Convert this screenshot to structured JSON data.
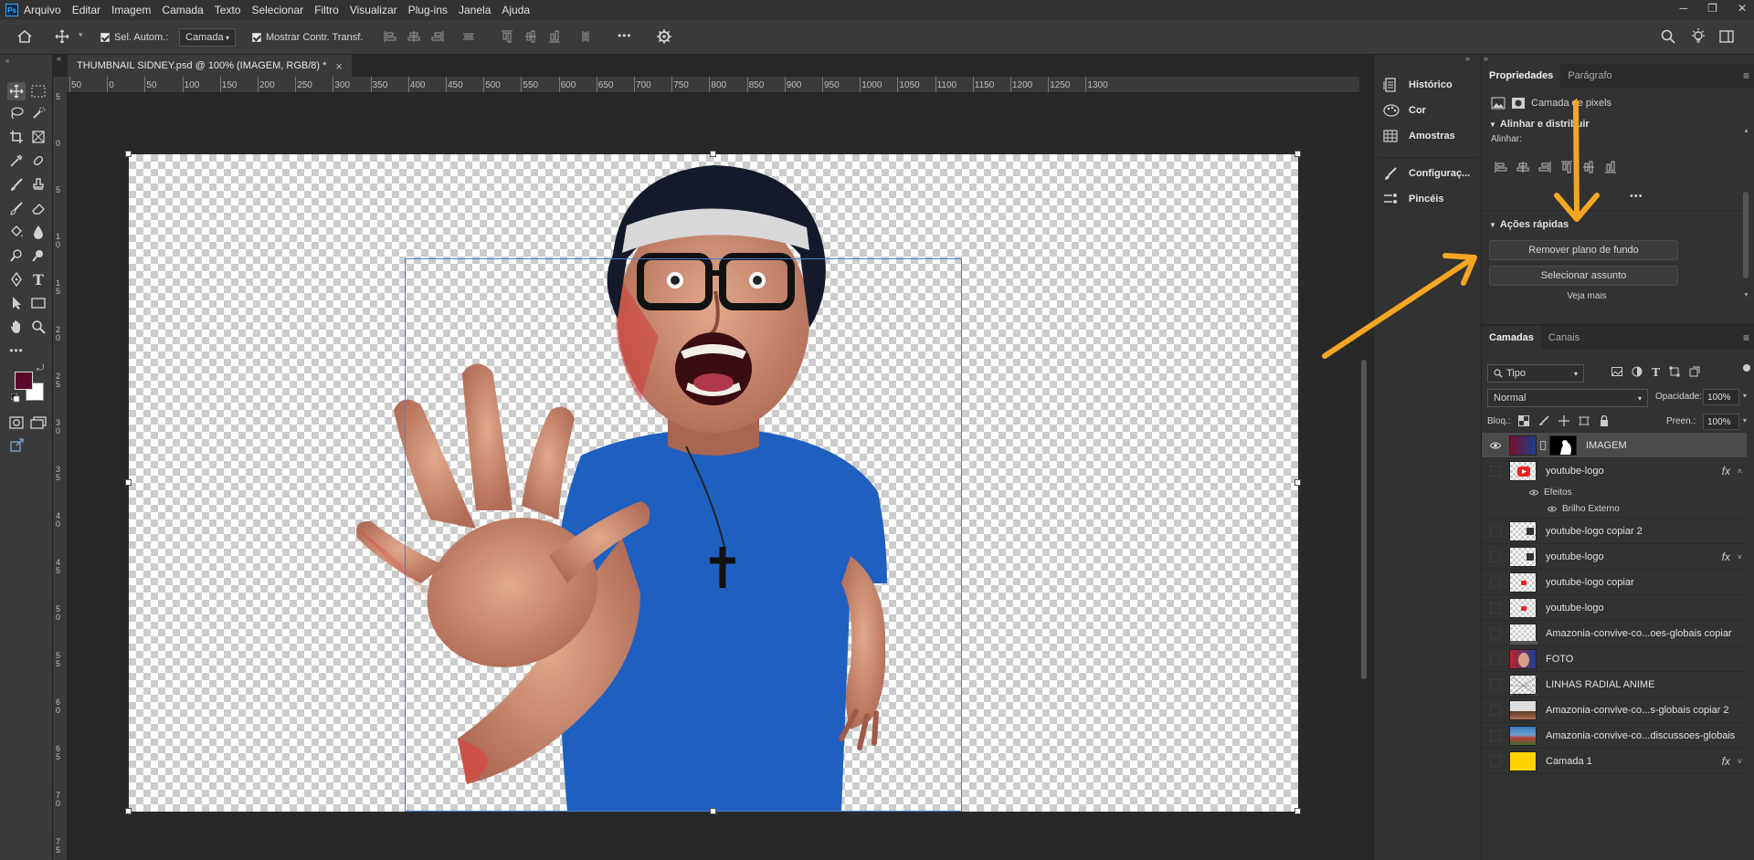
{
  "app": {
    "logo": "Ps"
  },
  "menu": [
    "Arquivo",
    "Editar",
    "Imagem",
    "Camada",
    "Texto",
    "Selecionar",
    "Filtro",
    "Visualizar",
    "Plug-ins",
    "Janela",
    "Ajuda"
  ],
  "options": {
    "auto_select_label": "Sel. Autom.:",
    "auto_select_value": "Camada",
    "show_transform_label": "Mostrar Contr. Transf.",
    "more": "•••"
  },
  "document": {
    "tab_title": "THUMBNAIL SIDNEY.psd @ 100% (IMAGEM, RGB/8) *",
    "close": "×"
  },
  "rulers": {
    "top": [
      "50",
      "0",
      "50",
      "100",
      "150",
      "200",
      "250",
      "300",
      "350",
      "400",
      "450",
      "500",
      "550",
      "600",
      "650",
      "700",
      "750",
      "800",
      "850",
      "900",
      "950",
      "1000",
      "1050",
      "1100",
      "1150",
      "1200",
      "1250",
      "1300"
    ],
    "left": [
      "5",
      "0",
      "5",
      "1 0",
      "1 5",
      "2 0",
      "2 5",
      "3 0",
      "3 5",
      "4 0",
      "4 5",
      "5 0",
      "5 5",
      "6 0",
      "6 5",
      "7 0",
      "7 5"
    ]
  },
  "colors": {
    "foreground": "#5a0a2a",
    "background": "#ffffff",
    "arrow": "#f5a623",
    "selection": "#4a7ed0"
  },
  "mid_panel": {
    "items": [
      "Histórico",
      "Cor",
      "Amostras",
      "Configuraç...",
      "Pincéis"
    ]
  },
  "properties": {
    "tabs": [
      "Propriedades",
      "Parágrafo"
    ],
    "layer_type": "Camada de pixels",
    "align_section": "Alinhar e distribuir",
    "align_label": "Alinhar:",
    "more": "•••",
    "quick_actions_title": "Ações rápidas",
    "remove_bg": "Remover plano de fundo",
    "select_subject": "Selecionar assunto",
    "see_more": "Veja mais"
  },
  "layers": {
    "tabs": [
      "Camadas",
      "Canais"
    ],
    "filter_label": "Tipo",
    "blend_mode": "Normal",
    "opacity_label": "Opacidade:",
    "opacity_value": "100%",
    "lock_label": "Bloq.:",
    "fill_label": "Preen.:",
    "fill_value": "100%",
    "effects_label": "Efeitos",
    "outer_glow_label": "Brilho Externo",
    "fx_label": "fx",
    "items": [
      {
        "name": "IMAGEM",
        "visible": true,
        "selected": true,
        "fx": false,
        "thumb": "photo-mask"
      },
      {
        "name": "youtube-logo",
        "visible": false,
        "selected": false,
        "fx": true,
        "thumb": "youtube"
      },
      {
        "name": "youtube-logo copiar 2",
        "visible": false,
        "selected": false,
        "fx": false,
        "thumb": "transparent"
      },
      {
        "name": "youtube-logo",
        "visible": false,
        "selected": false,
        "fx": true,
        "thumb": "transparent"
      },
      {
        "name": "youtube-logo copiar",
        "visible": false,
        "selected": false,
        "fx": false,
        "thumb": "youtube-small"
      },
      {
        "name": "youtube-logo",
        "visible": false,
        "selected": false,
        "fx": false,
        "thumb": "youtube-small"
      },
      {
        "name": "Amazonia-convive-co...oes-globais copiar",
        "visible": false,
        "selected": false,
        "fx": false,
        "thumb": "transparent"
      },
      {
        "name": "FOTO",
        "visible": false,
        "selected": false,
        "fx": false,
        "thumb": "photo"
      },
      {
        "name": "LINHAS RADIAL ANIME",
        "visible": false,
        "selected": false,
        "fx": false,
        "thumb": "transparent"
      },
      {
        "name": "Amazonia-convive-co...s-globais copiar 2",
        "visible": false,
        "selected": false,
        "fx": false,
        "thumb": "landscape"
      },
      {
        "name": "Amazonia-convive-co...discussoes-globais",
        "visible": false,
        "selected": false,
        "fx": false,
        "thumb": "landscape"
      },
      {
        "name": "Camada 1",
        "visible": false,
        "selected": false,
        "fx": true,
        "thumb": "yellow"
      }
    ]
  }
}
